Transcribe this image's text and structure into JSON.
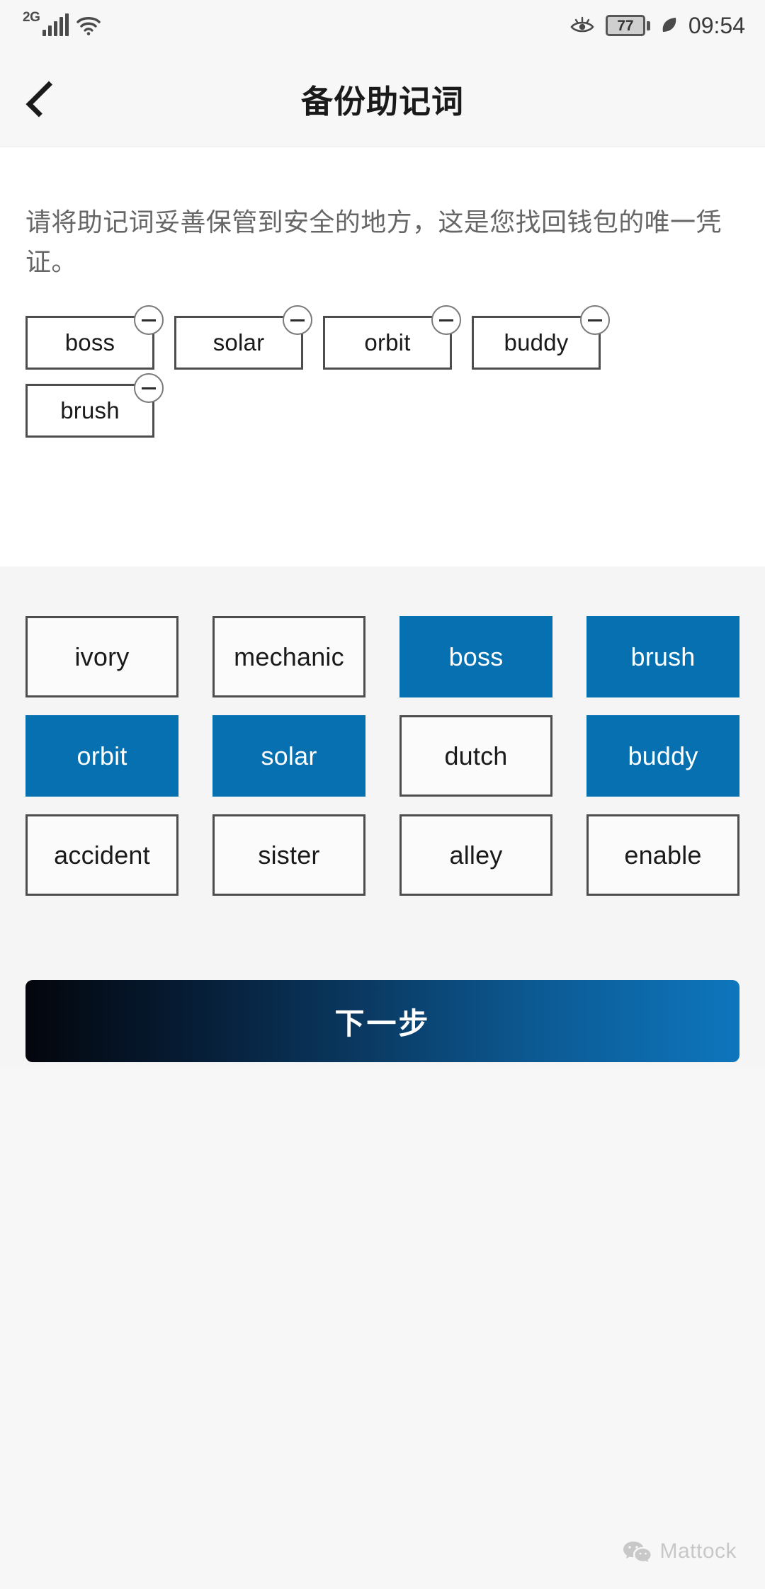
{
  "statusbar": {
    "network_label": "2G",
    "signal_icon": "signal-bars-icon",
    "wifi_icon": "wifi-icon",
    "eye_icon": "eye-icon",
    "battery_level": "77",
    "leaf_icon": "leaf-power-saving-icon",
    "time": "09:54"
  },
  "navbar": {
    "back_icon": "chevron-left-icon",
    "title": "备份助记词"
  },
  "content": {
    "description": "请将助记词妥善保管到安全的地方，这是您找回钱包的唯一凭证。"
  },
  "selected_chips": [
    {
      "label": "boss",
      "remove_icon": "minus-circle-icon"
    },
    {
      "label": "solar",
      "remove_icon": "minus-circle-icon"
    },
    {
      "label": "orbit",
      "remove_icon": "minus-circle-icon"
    },
    {
      "label": "buddy",
      "remove_icon": "minus-circle-icon"
    },
    {
      "label": "brush",
      "remove_icon": "minus-circle-icon"
    }
  ],
  "word_bank": [
    {
      "label": "ivory",
      "selected": false
    },
    {
      "label": "mechanic",
      "selected": false
    },
    {
      "label": "boss",
      "selected": true
    },
    {
      "label": "brush",
      "selected": true
    },
    {
      "label": "orbit",
      "selected": true
    },
    {
      "label": "solar",
      "selected": true
    },
    {
      "label": "dutch",
      "selected": false
    },
    {
      "label": "buddy",
      "selected": true
    },
    {
      "label": "accident",
      "selected": false
    },
    {
      "label": "sister",
      "selected": false
    },
    {
      "label": "alley",
      "selected": false
    },
    {
      "label": "enable",
      "selected": false
    }
  ],
  "next_button": {
    "label": "下一步"
  },
  "watermark": {
    "icon": "wechat-icon",
    "text": "Mattock"
  },
  "colors": {
    "accent_blue": "#0670b0",
    "panel_white": "#ffffff",
    "panel_gray": "#f5f5f5",
    "border_dark": "#4d4d4d",
    "text_primary": "#1a1a1a",
    "text_secondary": "#666666"
  }
}
